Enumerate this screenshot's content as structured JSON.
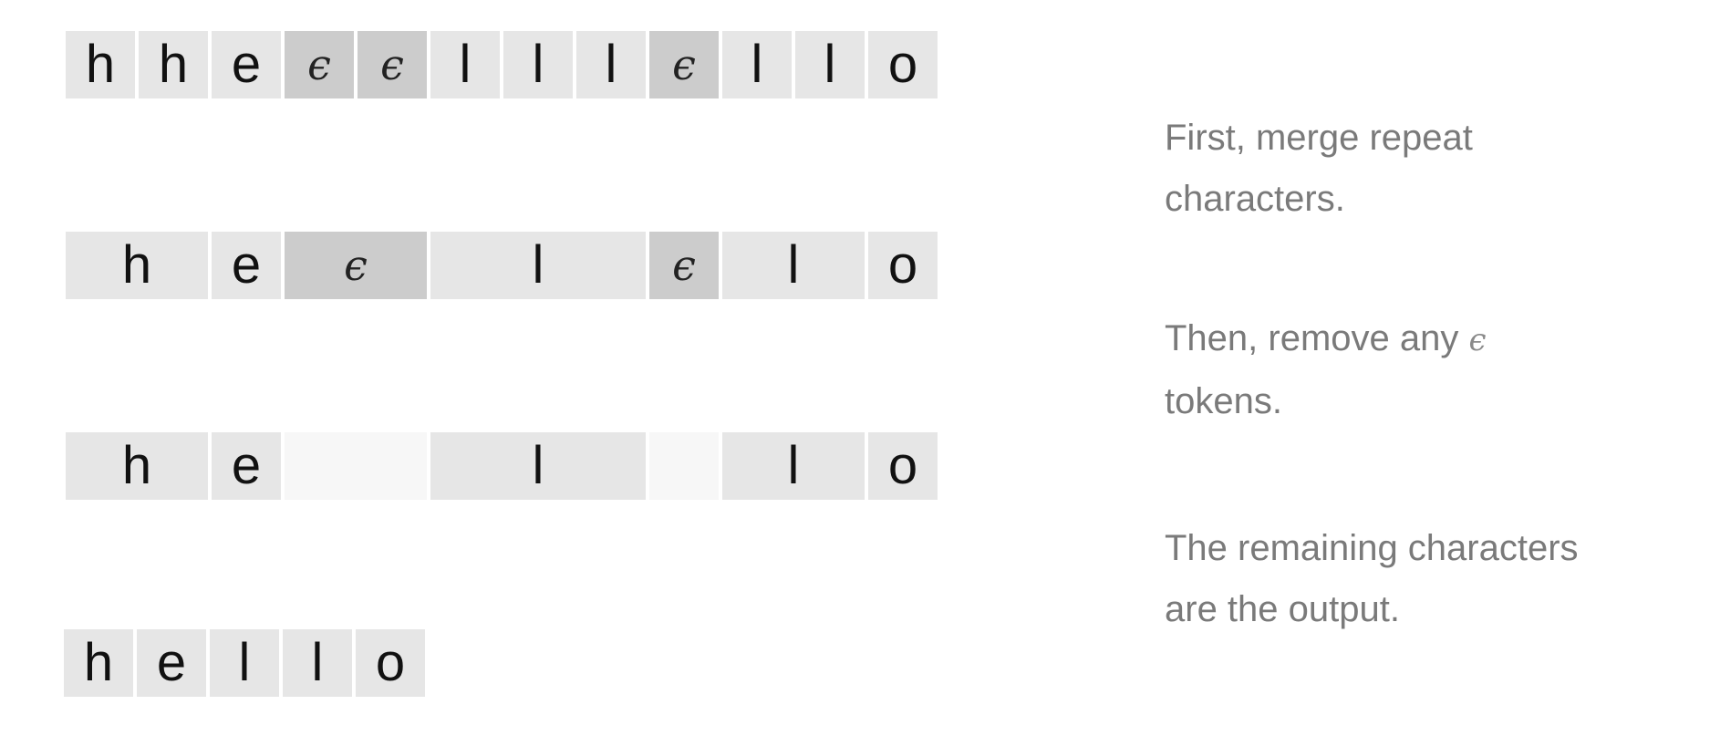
{
  "rows": [
    {
      "cells": [
        {
          "text": "h",
          "kind": "char"
        },
        {
          "text": "h",
          "kind": "char"
        },
        {
          "text": "e",
          "kind": "char"
        },
        {
          "text": "ϵ",
          "kind": "blank"
        },
        {
          "text": "ϵ",
          "kind": "blank"
        },
        {
          "text": "l",
          "kind": "char"
        },
        {
          "text": "l",
          "kind": "char"
        },
        {
          "text": "l",
          "kind": "char"
        },
        {
          "text": "ϵ",
          "kind": "blank"
        },
        {
          "text": "l",
          "kind": "char"
        },
        {
          "text": "l",
          "kind": "char"
        },
        {
          "text": "o",
          "kind": "char"
        }
      ]
    },
    {
      "cells": [
        {
          "text": "h",
          "kind": "char"
        },
        {
          "text": "e",
          "kind": "char"
        },
        {
          "text": "ϵ",
          "kind": "blank"
        },
        {
          "text": "l",
          "kind": "char"
        },
        {
          "text": "ϵ",
          "kind": "blank"
        },
        {
          "text": "l",
          "kind": "char"
        },
        {
          "text": "o",
          "kind": "char"
        }
      ]
    },
    {
      "cells": [
        {
          "text": "h",
          "kind": "char"
        },
        {
          "text": "e",
          "kind": "char"
        },
        {
          "text": "",
          "kind": "removed"
        },
        {
          "text": "l",
          "kind": "char"
        },
        {
          "text": "",
          "kind": "removed"
        },
        {
          "text": "l",
          "kind": "char"
        },
        {
          "text": "o",
          "kind": "char"
        }
      ]
    },
    {
      "cells": [
        {
          "text": "h",
          "kind": "char"
        },
        {
          "text": "e",
          "kind": "char"
        },
        {
          "text": "l",
          "kind": "char"
        },
        {
          "text": "l",
          "kind": "char"
        },
        {
          "text": "o",
          "kind": "char"
        }
      ]
    }
  ],
  "notes": {
    "merge_line1": "First, merge repeat",
    "merge_line2": "characters.",
    "remove_before": "Then, remove any",
    "remove_symbol": "ϵ",
    "remove_line2": "tokens.",
    "output_line1": "The remaining characters",
    "output_line2": "are the output."
  },
  "colors": {
    "char_cell": "#e6e6e6",
    "blank_cell": "#cccccc",
    "removed_cell": "#f7f7f7",
    "note_text": "#7a7a7a"
  }
}
